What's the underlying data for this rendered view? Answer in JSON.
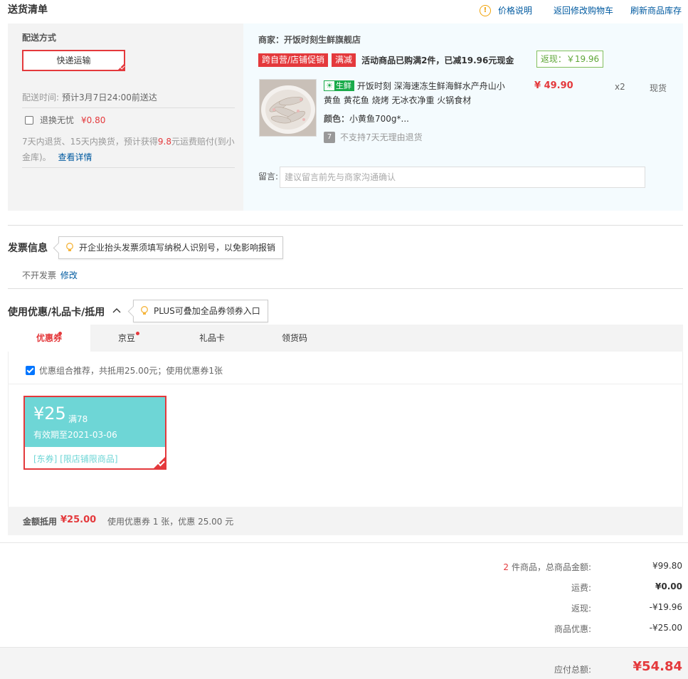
{
  "header": {
    "title": "送货清单",
    "links": [
      "价格说明",
      "返回修改购物车",
      "刷新商品库存"
    ]
  },
  "delivery": {
    "method_label": "配送方式",
    "method_value": "快递运输",
    "time_label": "配送时间:",
    "time_value": "预计3月7日24:00前送达",
    "return_checkbox_label": "退换无忧",
    "return_price": "¥0.80",
    "return_desc_1": "7天内退货、15天内换货，预计获得",
    "return_desc_amount": "9.8",
    "return_desc_2": "元运费赔付(到小金库)。",
    "return_details_link": "查看详情"
  },
  "merchant": {
    "name": "商家：开饭时刻生鲜旗舰店",
    "tags": [
      "跨自营/店铺促销",
      "满减"
    ],
    "promo_text": "活动商品已购满2件，已减19.96元现金",
    "rebate": "返现：￥19.96"
  },
  "product": {
    "tag_icon": "fish-icon",
    "tag_label": "生鲜",
    "name": "开饭时刻 深海速冻生鲜海鲜水产舟山小黄鱼 黄花鱼 烧烤 无冰衣净重 火锅食材",
    "price": "¥ 49.90",
    "qty": "x2",
    "stock": "现货",
    "color_label": "颜色：",
    "color_value": "小黄鱼700g*...",
    "return_badge": "7",
    "return_note": "不支持7天无理由退货"
  },
  "remark": {
    "label": "留言:",
    "placeholder": "建议留言前先与商家沟通确认"
  },
  "invoice": {
    "title": "发票信息",
    "tip": "开企业抬头发票须填写纳税人识别号，以免影响报销",
    "status": "不开发票",
    "edit_link": "修改"
  },
  "coupons": {
    "title": "使用优惠/礼品卡/抵用",
    "tip": "PLUS可叠加全品券领券入口",
    "tabs": [
      {
        "label": "优惠券",
        "dot": true
      },
      {
        "label": "京豆",
        "dot": true
      },
      {
        "label": "礼品卡",
        "dot": false
      },
      {
        "label": "领货码",
        "dot": false
      }
    ],
    "combo_text": "优惠组合推荐，共抵用25.00元；使用优惠券1张",
    "coupon": {
      "amount": "¥25",
      "condition": "满78",
      "valid": "有效期至2021-03-06",
      "scope": "[东券]  [限店铺限商品]"
    },
    "footer_label": "金额抵用",
    "footer_amount": "¥25.00",
    "footer_desc": "使用优惠券 1 张，优惠 25.00 元"
  },
  "summary": {
    "count": "2",
    "rows": [
      {
        "label": "件商品，总商品金额:",
        "value": "¥99.80"
      },
      {
        "label": "运费:",
        "value": "¥0.00"
      },
      {
        "label": "返现:",
        "value": "-¥19.96"
      },
      {
        "label": "商品优惠:",
        "value": "-¥25.00"
      }
    ],
    "total_label": "应付总额:",
    "total_value": "¥54.84"
  },
  "colors": {
    "accent": "#e4393c",
    "link": "#005aa0",
    "coupon": "#6ed6d6",
    "fresh": "#1aab4a"
  }
}
